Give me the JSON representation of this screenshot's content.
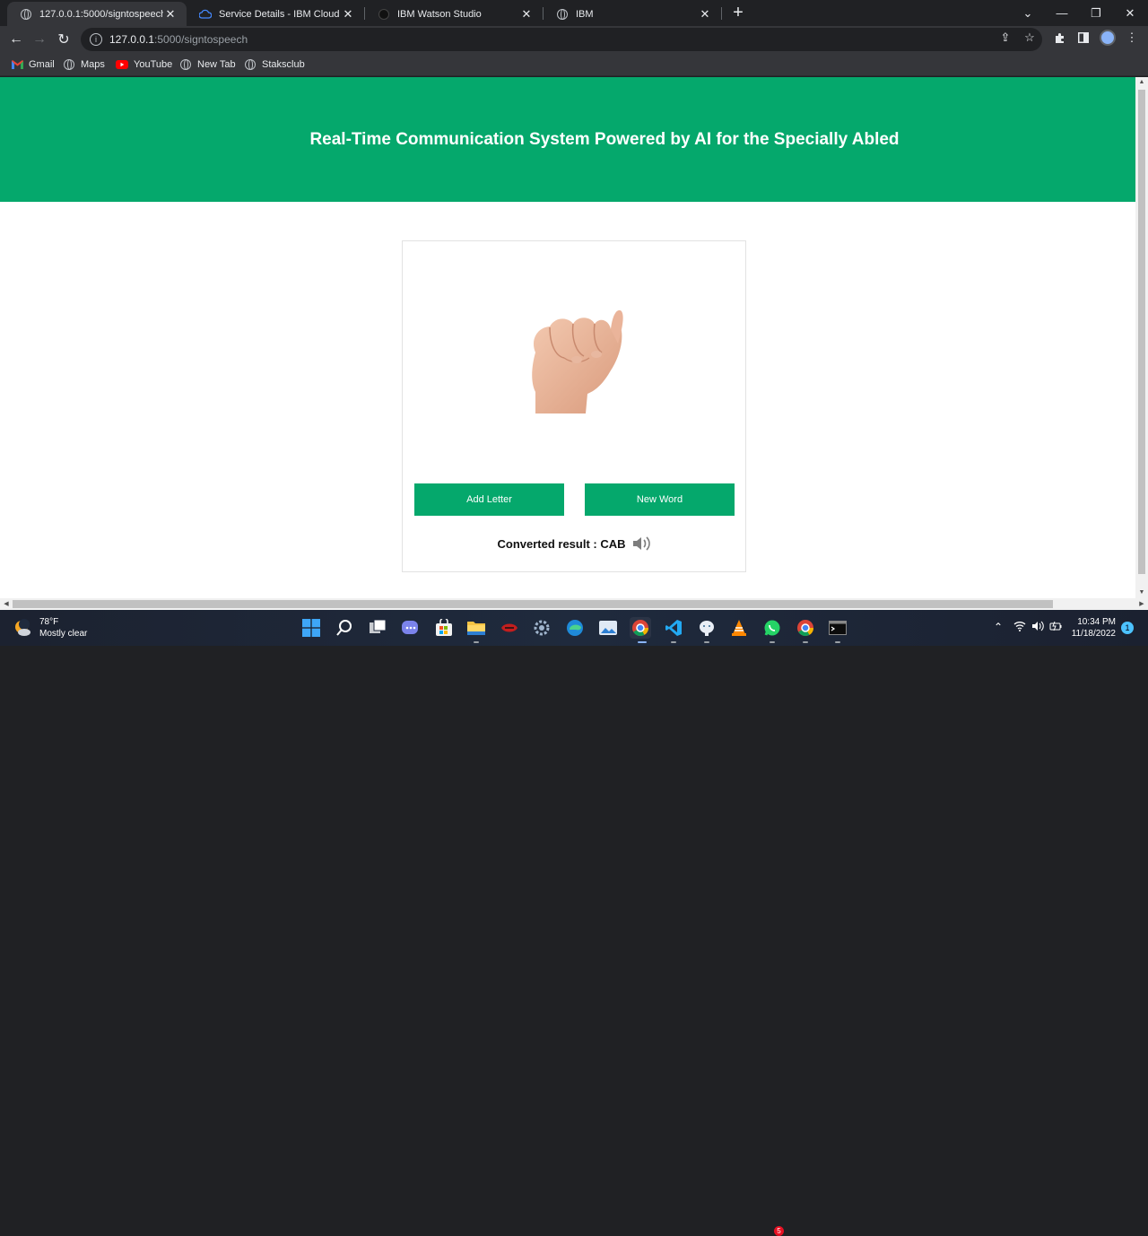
{
  "browser": {
    "tabs": [
      {
        "title": "127.0.0.1:5000/signtospeech",
        "active": true
      },
      {
        "title": "Service Details - IBM Cloud",
        "active": false
      },
      {
        "title": "IBM Watson Studio",
        "active": false
      },
      {
        "title": "IBM",
        "active": false
      }
    ],
    "url_host": "127.0.0.1",
    "url_path": ":5000/signtospeech",
    "bookmarks": [
      {
        "label": "Gmail",
        "icon": "gmail-icon"
      },
      {
        "label": "Maps",
        "icon": "globe-icon"
      },
      {
        "label": "YouTube",
        "icon": "youtube-icon"
      },
      {
        "label": "New Tab",
        "icon": "globe-icon"
      },
      {
        "label": "Staksclub",
        "icon": "globe-icon"
      }
    ]
  },
  "page": {
    "header_title": "Real-Time Communication System Powered by AI for the Specially Abled",
    "add_letter_label": "Add Letter",
    "new_word_label": "New Word",
    "result_label": "Converted result : CAB",
    "accent_color": "#05a86c"
  },
  "taskbar": {
    "weather_temp": "78°F",
    "weather_desc": "Mostly clear",
    "time": "10:34 PM",
    "date": "11/18/2022",
    "whatsapp_badge": "5",
    "notification_count": "1"
  }
}
